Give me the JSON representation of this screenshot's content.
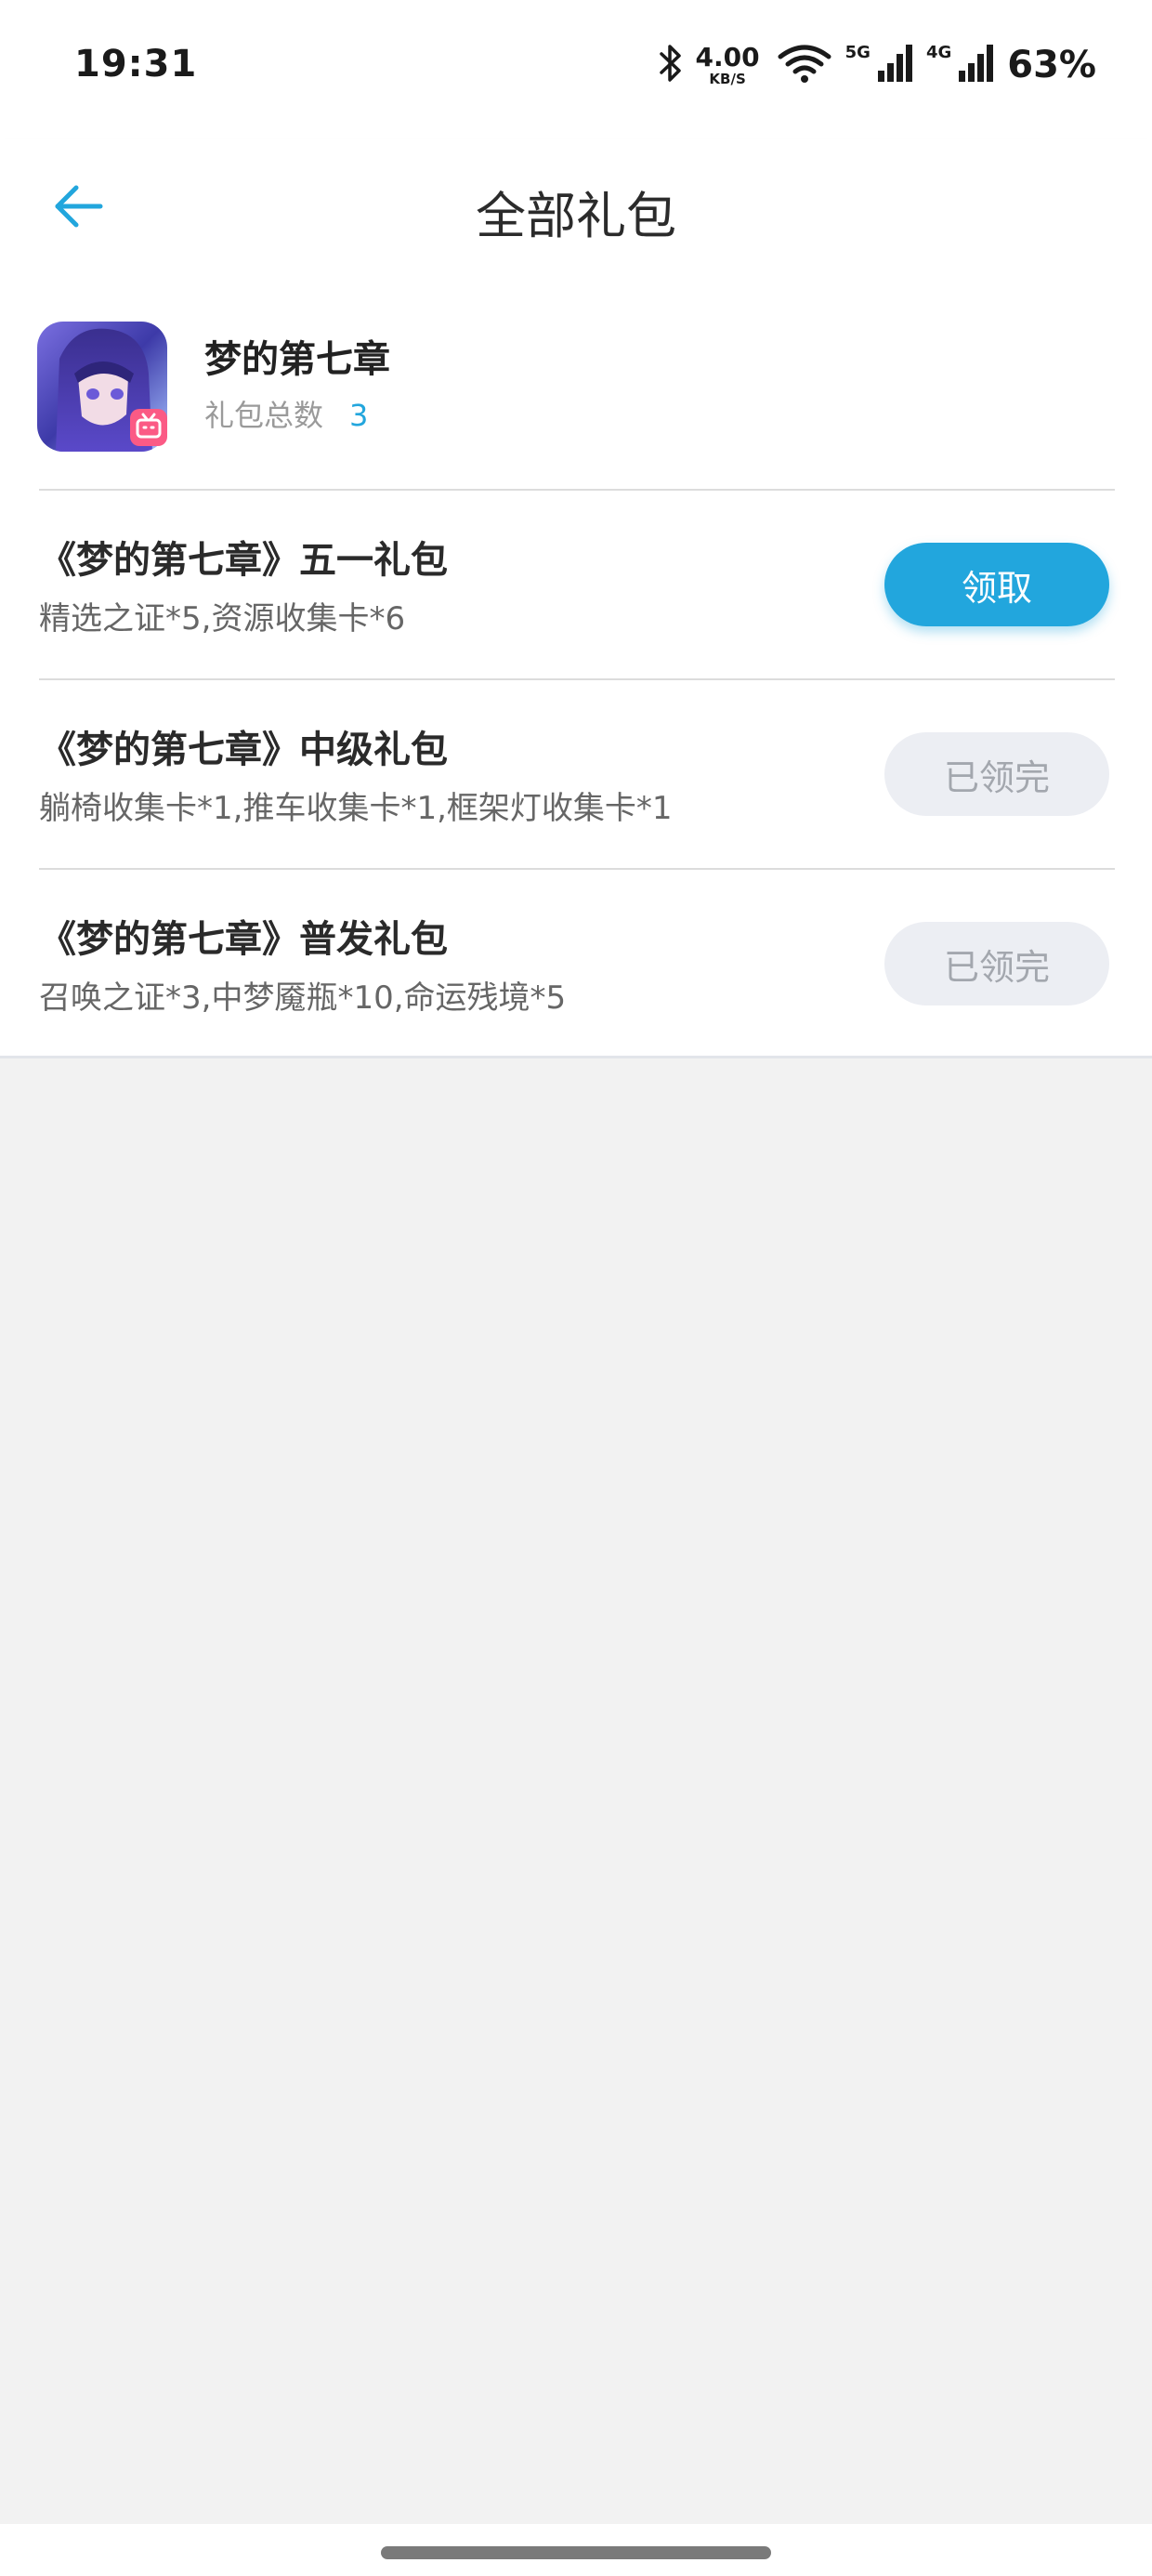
{
  "status_bar": {
    "time": "19:31",
    "net_speed_value": "4.00",
    "net_speed_unit": "KB/S",
    "sim1_label": "5G",
    "sim2_label": "4G",
    "battery": "63%",
    "icons": [
      "bluetooth-icon",
      "wifi-icon",
      "signal-icon",
      "signal-icon"
    ]
  },
  "header": {
    "title": "全部礼包",
    "back_icon": "arrow-left-icon"
  },
  "game": {
    "name": "梦的第七章",
    "gift_total_label": "礼包总数",
    "gift_total_count": "3",
    "badge_icon": "bilibili-tv-icon"
  },
  "gifts": [
    {
      "title": "《梦的第七章》五一礼包",
      "desc": "精选之证*5,资源收集卡*6",
      "button": "领取",
      "state": "available"
    },
    {
      "title": "《梦的第七章》中级礼包",
      "desc": "躺椅收集卡*1,推车收集卡*1,框架灯收集卡*1",
      "button": "已领完",
      "state": "claimed-out"
    },
    {
      "title": "《梦的第七章》普发礼包",
      "desc": "召唤之证*3,中梦魇瓶*10,命运残境*5",
      "button": "已领完",
      "state": "claimed-out"
    }
  ],
  "colors": {
    "accent": "#22a6dd",
    "disabled_bg": "#eceef3",
    "disabled_text": "#a3a7ae",
    "page_bg": "#f2f2f2"
  }
}
